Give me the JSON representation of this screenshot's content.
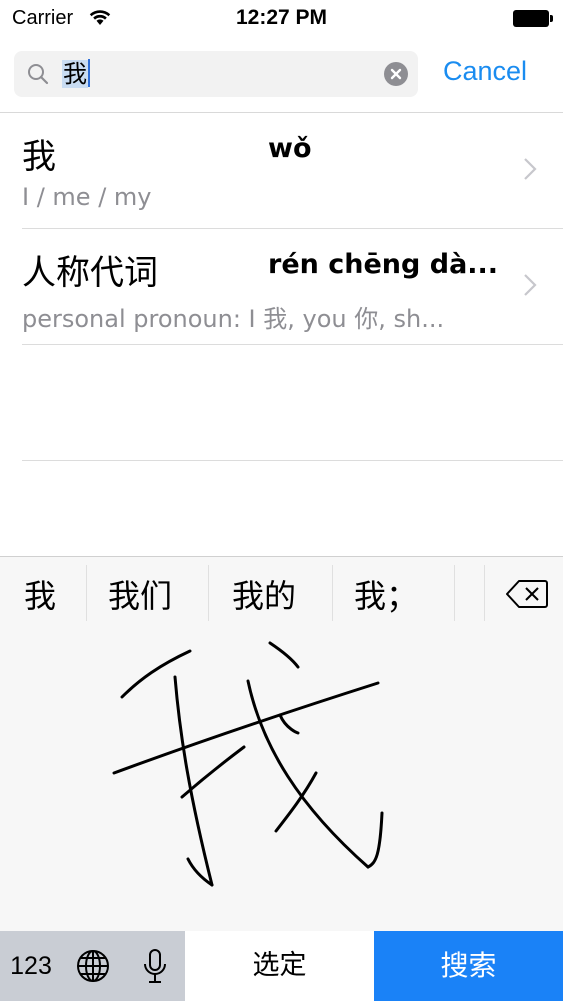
{
  "status_bar": {
    "carrier": "Carrier",
    "time": "12:27 PM"
  },
  "search": {
    "query": "我",
    "cancel_label": "Cancel"
  },
  "results": [
    {
      "hanzi": "我",
      "pinyin": "wǒ",
      "meaning": "I / me / my"
    },
    {
      "hanzi": "人称代词",
      "pinyin": "rén chēng dà...",
      "meaning": "personal pronoun: I 我, you 你, sh..."
    }
  ],
  "keyboard": {
    "candidates": [
      "我",
      "我们",
      "我的",
      "我；"
    ],
    "numbers_key": "123",
    "select_key": "选定",
    "search_key": "搜索"
  },
  "colors": {
    "accent": "#1a8cf0",
    "search_key_bg": "#1a82f7",
    "secondary_text": "#8e8e93"
  }
}
